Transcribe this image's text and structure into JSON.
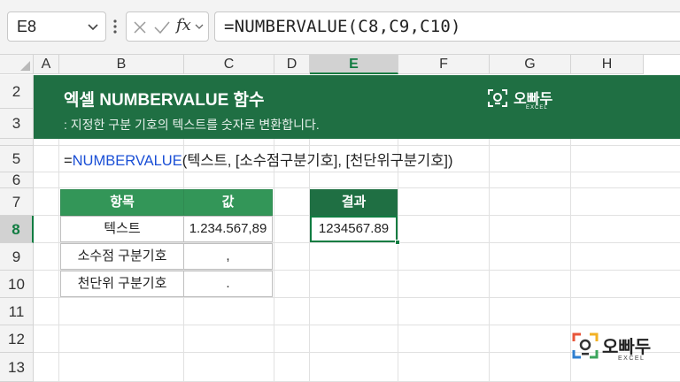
{
  "formula_bar": {
    "name_box": "E8",
    "fx_label": "fx",
    "formula": "=NUMBERVALUE(C8,C9,C10)"
  },
  "columns": [
    "A",
    "B",
    "C",
    "D",
    "E",
    "F",
    "G",
    "H"
  ],
  "active_column": "E",
  "rows": [
    "2",
    "3",
    "4",
    "5",
    "6",
    "7",
    "8",
    "9",
    "10",
    "11",
    "12",
    "13"
  ],
  "active_row": "8",
  "banner": {
    "title": "엑셀 NUMBERVALUE 함수",
    "subtitle": ": 지정한 구분 기호의 텍스트를 숫자로 변환합니다.",
    "logo_name": "오빠두",
    "logo_sub": "EXCEL",
    "color": "#1f6f43"
  },
  "syntax": {
    "prefix": "=",
    "function": "NUMBERVALUE",
    "args": "(텍스트, [소수점구분기호], [천단위구분기호])"
  },
  "table": {
    "headers": [
      "항목",
      "값"
    ],
    "rows": [
      [
        "텍스트",
        "1.234.567,89"
      ],
      [
        "소수점 구분기호",
        ","
      ],
      [
        "천단위 구분기호",
        "."
      ]
    ]
  },
  "result": {
    "header": "결과",
    "value": "1234567.89"
  },
  "footer_logo": {
    "name": "오빠두",
    "sub": "EXCEL"
  }
}
